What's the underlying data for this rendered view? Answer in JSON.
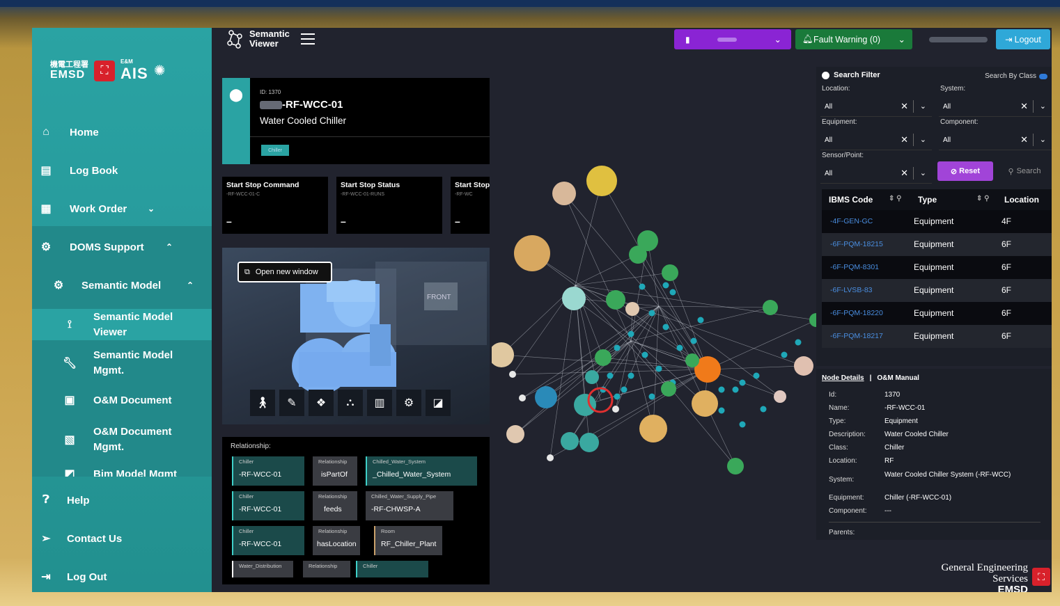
{
  "sidebar": {
    "logo": {
      "cn": "機電工程署",
      "emsd": "EMSD",
      "ais": "AIS",
      "em": "E&M"
    },
    "items": [
      {
        "label": "Home"
      },
      {
        "label": "Log Book"
      },
      {
        "label": "Work Order"
      },
      {
        "label": "DOMS Support"
      },
      {
        "label": "Semantic Model"
      },
      {
        "label": "Semantic Model Viewer"
      },
      {
        "label": "Semantic Model Mgmt."
      },
      {
        "label": "O&M Document"
      },
      {
        "label": "O&M Document Mgmt."
      },
      {
        "label": "Bim Model Mgmt"
      },
      {
        "label": "Help"
      },
      {
        "label": "Contact Us"
      },
      {
        "label": "Log Out"
      }
    ]
  },
  "topbar": {
    "brand_line1": "Semantic",
    "brand_line2": "Viewer",
    "fault_warning": "Fault Warning (0)",
    "logout": "Logout"
  },
  "device": {
    "id": "ID: 1370",
    "name": "-RF-WCC-01",
    "description": "Water Cooled Chiller",
    "tag": "Chiller"
  },
  "points": [
    {
      "title": "Start Stop Command",
      "sub": "-RF-WCC-01-C",
      "value": "–"
    },
    {
      "title": "Start Stop Status",
      "sub": "-RF-WCC-01-RUNS",
      "value": "–"
    },
    {
      "title": "Start Stop",
      "sub": "-RF-WC",
      "value": "–"
    }
  ],
  "view3d": {
    "open_new_window": "Open new window",
    "front_label": "FRONT"
  },
  "relationship": {
    "title": "Relationship:",
    "rows": [
      [
        {
          "k": "Chiller",
          "v": "-RF-WCC-01"
        },
        {
          "k": "Relationship",
          "v": "isPartOf"
        },
        {
          "k": "Chilled_Water_System",
          "v": "_Chilled_Water_System"
        }
      ],
      [
        {
          "k": "Chiller",
          "v": "-RF-WCC-01"
        },
        {
          "k": "Relationship",
          "v": "feeds"
        },
        {
          "k": "Chilled_Water_Supply_Pipe",
          "v": "-RF-CHWSP-A"
        }
      ],
      [
        {
          "k": "Chiller",
          "v": "-RF-WCC-01"
        },
        {
          "k": "Relationship",
          "v": "hasLocation"
        },
        {
          "k": "Room",
          "v": "RF_Chiller_Plant"
        }
      ],
      [
        {
          "k": "Water_Distribution",
          "v": ""
        },
        {
          "k": "Relationship",
          "v": ""
        },
        {
          "k": "Chiller",
          "v": ""
        }
      ]
    ]
  },
  "filter": {
    "title": "Search Filter",
    "search_by_class": "Search By Class",
    "location_label": "Location:",
    "location_value": "All",
    "system_label": "System:",
    "system_value": "All",
    "equipment_label": "Equipment:",
    "equipment_value": "All",
    "component_label": "Component:",
    "component_value": "All",
    "sensor_label": "Sensor/Point:",
    "sensor_value": "All",
    "reset": "Reset",
    "search": "Search",
    "columns": [
      "IBMS Code",
      "Type",
      "Location"
    ],
    "rows": [
      {
        "code": "-4F-GEN-GC",
        "type": "Equipment",
        "location": "4F"
      },
      {
        "code": "-6F-PQM-18215",
        "type": "Equipment",
        "location": "6F"
      },
      {
        "code": "-6F-PQM-8301",
        "type": "Equipment",
        "location": "6F"
      },
      {
        "code": "-6F-LVSB-83",
        "type": "Equipment",
        "location": "6F"
      },
      {
        "code": "-6F-PQM-18220",
        "type": "Equipment",
        "location": "6F"
      },
      {
        "code": "-6F-PQM-18217",
        "type": "Equipment",
        "location": "6F"
      }
    ]
  },
  "node_details": {
    "tab1": "Node Details",
    "tab2": "O&M Manual",
    "fields": [
      {
        "k": "Id:",
        "v": "1370"
      },
      {
        "k": "Name:",
        "v": "-RF-WCC-01"
      },
      {
        "k": "Type:",
        "v": "Equipment"
      },
      {
        "k": "Description:",
        "v": "Water Cooled Chiller"
      },
      {
        "k": "Class:",
        "v": "Chiller"
      },
      {
        "k": "Location:",
        "v": "RF"
      },
      {
        "k": "System:",
        "v": "Water Cooled Chiller System (-RF-WCC)"
      },
      {
        "k": "Equipment:",
        "v": "Chiller (-RF-WCC-01)"
      },
      {
        "k": "Component:",
        "v": "---"
      },
      {
        "k": "Parents:",
        "v": ""
      }
    ]
  },
  "footer": {
    "line1": "General Engineering Services",
    "line2": "EMSD"
  },
  "colors": {
    "teal": "#2aa3a3",
    "purple": "#8a24d4",
    "green": "#1a7a3a",
    "orange": "#f07a1a",
    "gold": "#c9a24a"
  }
}
